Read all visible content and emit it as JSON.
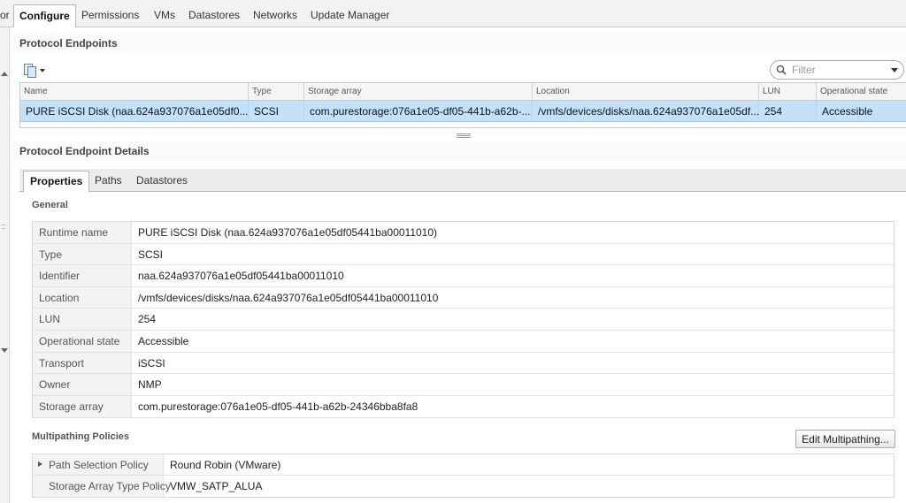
{
  "top_tabs": [
    {
      "label": "or"
    },
    {
      "label": "Configure"
    },
    {
      "label": "Permissions"
    },
    {
      "label": "VMs"
    },
    {
      "label": "Datastores"
    },
    {
      "label": "Networks"
    },
    {
      "label": "Update Manager"
    }
  ],
  "protocol_endpoints": {
    "title": "Protocol Endpoints",
    "filter_placeholder": "Filter",
    "columns": [
      "Name",
      "Type",
      "Storage array",
      "Location",
      "LUN",
      "Operational state"
    ],
    "rows": [
      [
        "PURE iSCSI Disk (naa.624a937076a1e05df0...",
        "SCSI",
        "com.purestorage:076a1e05-df05-441b-a62b-...",
        "/vmfs/devices/disks/naa.624a937076a1e05df...",
        "254",
        "Accessible"
      ]
    ]
  },
  "details": {
    "title": "Protocol Endpoint Details",
    "tabs": [
      "Properties",
      "Paths",
      "Datastores"
    ],
    "general_title": "General",
    "properties": [
      {
        "label": "Runtime name",
        "value": "PURE iSCSI Disk (naa.624a937076a1e05df05441ba00011010)"
      },
      {
        "label": "Type",
        "value": "SCSI"
      },
      {
        "label": "Identifier",
        "value": "naa.624a937076a1e05df05441ba00011010"
      },
      {
        "label": "Location",
        "value": "/vmfs/devices/disks/naa.624a937076a1e05df05441ba00011010"
      },
      {
        "label": "LUN",
        "value": "254"
      },
      {
        "label": "Operational state",
        "value": "Accessible"
      },
      {
        "label": "Transport",
        "value": "iSCSI"
      },
      {
        "label": "Owner",
        "value": "NMP"
      },
      {
        "label": "Storage array",
        "value": "com.purestorage:076a1e05-df05-441b-a62b-24346bba8fa8"
      }
    ],
    "multipathing_title": "Multipathing Policies",
    "edit_button": "Edit Multipathing...",
    "multipathing": [
      {
        "label": "Path Selection Policy",
        "value": "Round Robin (VMware)"
      },
      {
        "label": "Storage Array Type Policy",
        "value": "VMW_SATP_ALUA"
      }
    ]
  }
}
